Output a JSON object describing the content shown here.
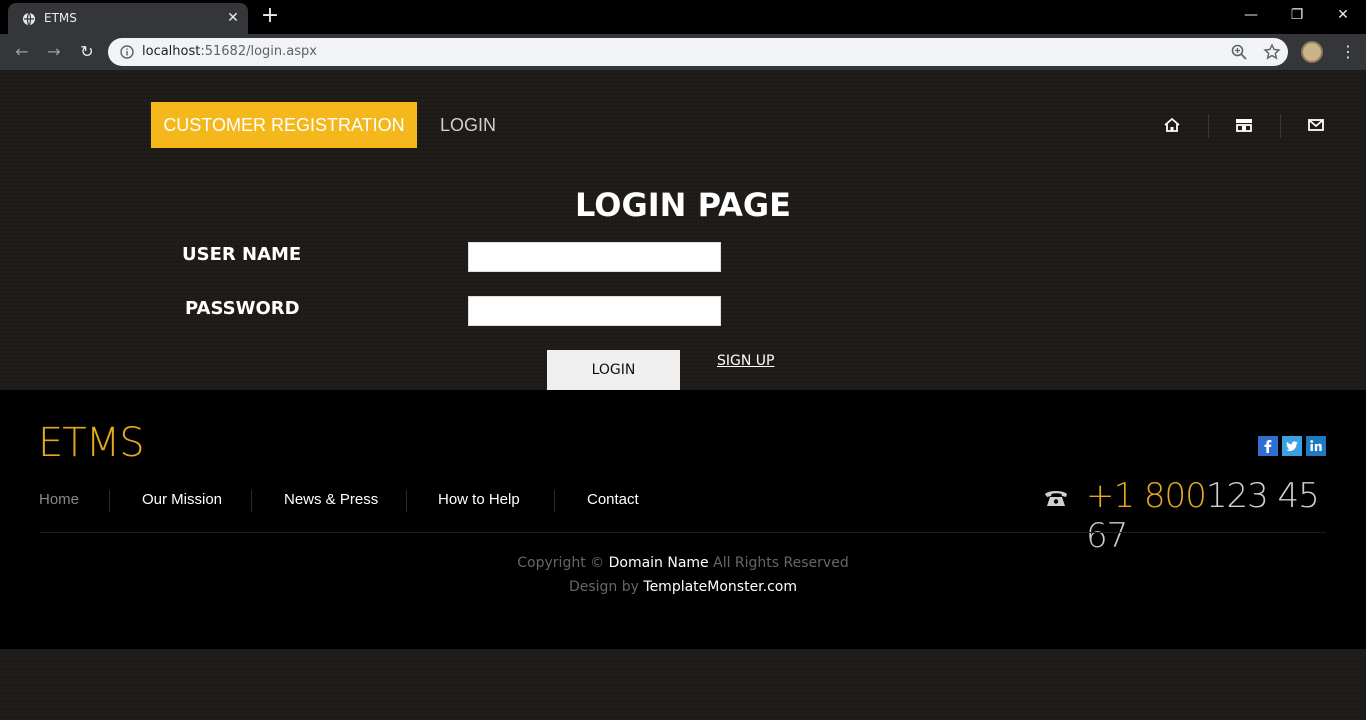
{
  "browser": {
    "tab_title": "ETMS",
    "url_host": "localhost",
    "url_path": ":51682/login.aspx",
    "icons": [
      "globe-icon",
      "close-icon",
      "plus-icon",
      "minimize-icon",
      "restore-icon",
      "close-window-icon",
      "back-icon",
      "forward-icon",
      "reload-icon",
      "info-icon",
      "zoom-icon",
      "star-icon",
      "menu-icon"
    ]
  },
  "header": {
    "nav_active": "CUSTOMER REGISTRATION",
    "nav_login": "LOGIN",
    "icons": [
      "home-icon",
      "store-icon",
      "mail-icon"
    ],
    "accent_color": "#f5b81c"
  },
  "form": {
    "title": "LOGIN PAGE",
    "username_label": "USER NAME",
    "password_label": "PASSWORD",
    "username_value": "",
    "password_value": "",
    "login_button": "LOGIN",
    "signup_link": "SIGN UP"
  },
  "footer": {
    "brand": "ETMS",
    "social_icons": [
      "facebook-icon",
      "twitter-icon",
      "linkedin-icon"
    ],
    "nav": [
      "Home",
      "Our Mission",
      "News & Press",
      "How to Help",
      "Contact"
    ],
    "phone_prefix": "+1 800",
    "phone_rest": "123 45 67",
    "copyright_pre": "Copyright ©",
    "copyright_name": "Domain Name",
    "copyright_post": "All Rights Reserved",
    "design_pre": "Design by",
    "design_name": "TemplateMonster.com",
    "brand_color": "#e4a91c"
  }
}
